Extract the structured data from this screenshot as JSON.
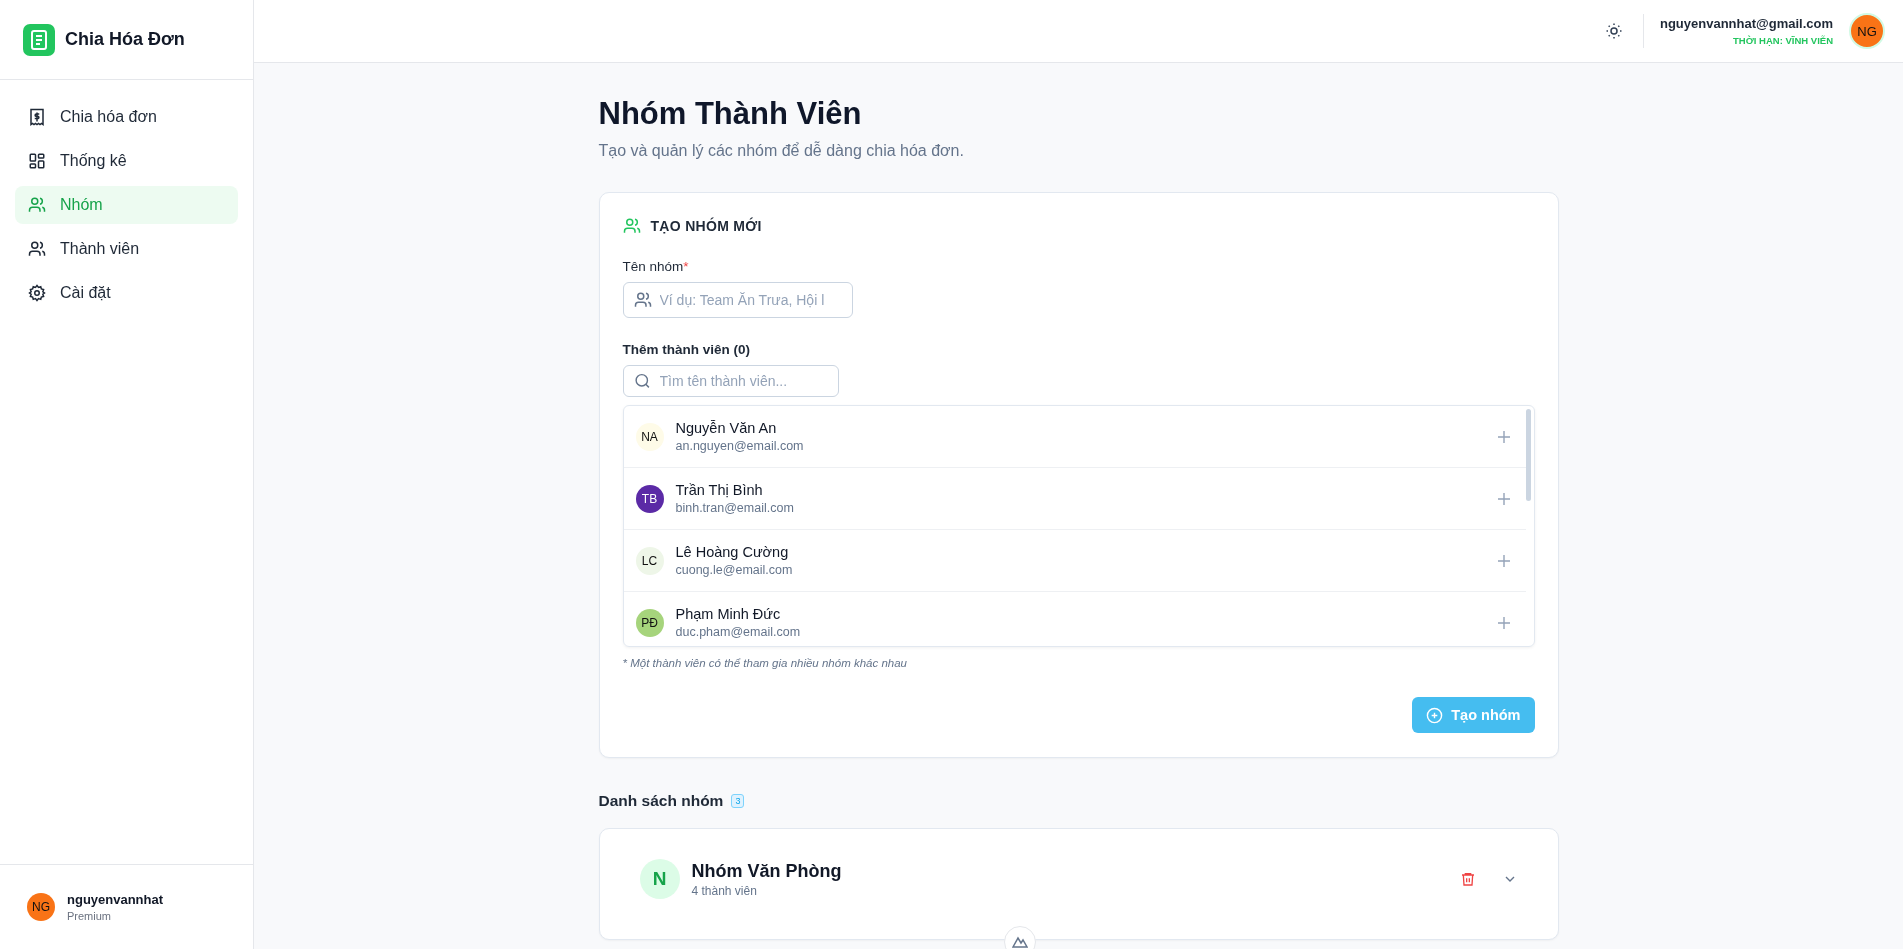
{
  "sidebar": {
    "brand": "Chia Hóa Đơn",
    "items": [
      {
        "label": "Chia hóa đơn",
        "selected": false
      },
      {
        "label": "Thống kê",
        "selected": false
      },
      {
        "label": "Nhóm",
        "selected": true
      },
      {
        "label": "Thành viên",
        "selected": false
      },
      {
        "label": "Cài đặt",
        "selected": false
      }
    ],
    "user": {
      "initials": "NG",
      "name": "nguyenvannhat",
      "plan": "Premium"
    }
  },
  "header": {
    "email": "nguyenvannhat@gmail.com",
    "license": "THỜI HẠN: VĨNH VIỄN",
    "initials": "NG"
  },
  "page": {
    "title": "Nhóm Thành Viên",
    "subtitle": "Tạo và quản lý các nhóm để dễ dàng chia hóa đơn."
  },
  "create_form": {
    "heading": "TẠO NHÓM MỚI",
    "name_label": "Tên nhóm",
    "required_mark": "*",
    "name_placeholder": "Ví dụ: Team Ăn Trưa, Hội l",
    "members_label": "Thêm thành viên (0)",
    "search_placeholder": "Tìm tên thành viên...",
    "members": [
      {
        "initials": "NA",
        "name": "Nguyễn Văn An",
        "email": "an.nguyen@email.com",
        "color": "#fefbe8"
      },
      {
        "initials": "TB",
        "name": "Trần Thị Bình",
        "email": "binh.tran@email.com",
        "color": "#5b2aa6"
      },
      {
        "initials": "LC",
        "name": "Lê Hoàng Cường",
        "email": "cuong.le@email.com",
        "color": "#eef6e8"
      },
      {
        "initials": "PĐ",
        "name": "Phạm Minh Đức",
        "email": "duc.pham@email.com",
        "color": "#a6d47c"
      }
    ],
    "note": "* Một thành viên có thể tham gia nhiều nhóm khác nhau",
    "submit": "Tạo nhóm"
  },
  "group_list": {
    "heading": "Danh sách nhóm",
    "count": "3",
    "groups": [
      {
        "initial": "N",
        "name": "Nhóm Văn Phòng",
        "members": "4 thành viên"
      }
    ]
  }
}
